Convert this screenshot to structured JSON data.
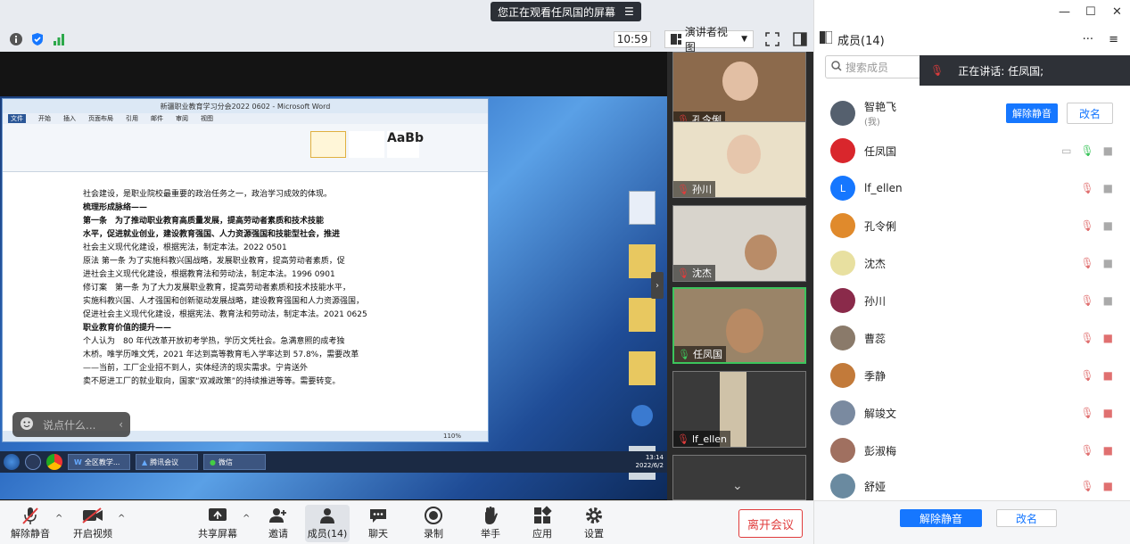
{
  "banner": {
    "text": "您正在观看任凤国的屏幕"
  },
  "toolbar": {
    "time": "10:59",
    "view_mode": "演讲者视图"
  },
  "word": {
    "title": "新疆职业教育学习分会2022 0602 - Microsoft Word",
    "tabs": [
      "文件",
      "开始",
      "插入",
      "页面布局",
      "引用",
      "邮件",
      "审阅",
      "视图"
    ],
    "lines": [
      "社会建设，是职业院校最重要的政治任务之一，政治学习成效的体现。",
      "梳理形成脉络——",
      "第一条　为了推动职业教育高质量发展，提高劳动者素质和技术技能",
      "水平，促进就业创业，建设教育强国、人力资源强国和技能型社会，推进",
      "社会主义现代化建设，根据宪法，制定本法。2022 0501",
      "原法 第一条 为了实施科教兴国战略，发展职业教育，提高劳动者素质，促",
      "进社会主义现代化建设，根据教育法和劳动法，制定本法。1996 0901",
      "修订案　第一条 为了大力发展职业教育，提高劳动者素质和技术技能水平，",
      "实施科教兴国、人才强国和创新驱动发展战略，建设教育强国和人力资源强国，",
      "促进社会主义现代化建设，根据宪法、教育法和劳动法，制定本法。2021 0625",
      "职业教育价值的提升——",
      "个人认为　80 年代改革开放初考学热，学历文凭社会。急满意照的成考独",
      "木桥。唯学历唯文凭，2021 年达到高等教育毛入学率达到 57.8%，需要改革",
      "——当前，工厂企业招不到人，实体经济的现实需求。宁肯送外",
      "卖不愿进工厂的就业取向，国家“双减政策”的持续推进等等。需要转变。"
    ],
    "status": "110%"
  },
  "taskbar": {
    "apps": [
      "全区教学...",
      "腾讯会议",
      "微信"
    ],
    "clock": "13:14",
    "date": "2022/6/2"
  },
  "chat_float": {
    "placeholder": "说点什么..."
  },
  "tiles": [
    {
      "name": "孔令俐",
      "mic": "muted"
    },
    {
      "name": "孙川",
      "mic": "muted"
    },
    {
      "name": "沈杰",
      "mic": "muted"
    },
    {
      "name": "任凤国",
      "mic": "on"
    },
    {
      "name": "lf_ellen",
      "mic": "muted"
    }
  ],
  "bottom": {
    "mute": "解除静音",
    "video": "开启视频",
    "share": "共享屏幕",
    "invite": "邀请",
    "members": "成员(14)",
    "chat": "聊天",
    "record": "录制",
    "raise": "举手",
    "apps": "应用",
    "settings": "设置",
    "leave": "离开会议"
  },
  "panel": {
    "title": "成员(14)",
    "search_placeholder": "搜索成员",
    "speaking": "正在讲话: 任凤国;",
    "me_tag": "(我)",
    "unmute_btn": "解除静音",
    "rename_btn": "改名",
    "members": [
      {
        "name": "智艳飞",
        "avatar_color": "#55606e"
      },
      {
        "name": "任凤国",
        "avatar_color": "#d9262c"
      },
      {
        "name": "lf_ellen",
        "avatar_color": "#1677ff",
        "initial": "L"
      },
      {
        "name": "孔令俐",
        "avatar_color": "#e08a2c"
      },
      {
        "name": "沈杰",
        "avatar_color": "#e8e0a0"
      },
      {
        "name": "孙川",
        "avatar_color": "#8a2a4a"
      },
      {
        "name": "曹蕊",
        "avatar_color": "#8a7a6a"
      },
      {
        "name": "季静",
        "avatar_color": "#c27a3a"
      },
      {
        "name": "解竣文",
        "avatar_color": "#7a8aa0"
      },
      {
        "name": "彭淑梅",
        "avatar_color": "#a07060"
      },
      {
        "name": "舒娅",
        "avatar_color": "#6a8aa0"
      }
    ],
    "foot_unmute": "解除静音",
    "foot_rename": "改名"
  }
}
